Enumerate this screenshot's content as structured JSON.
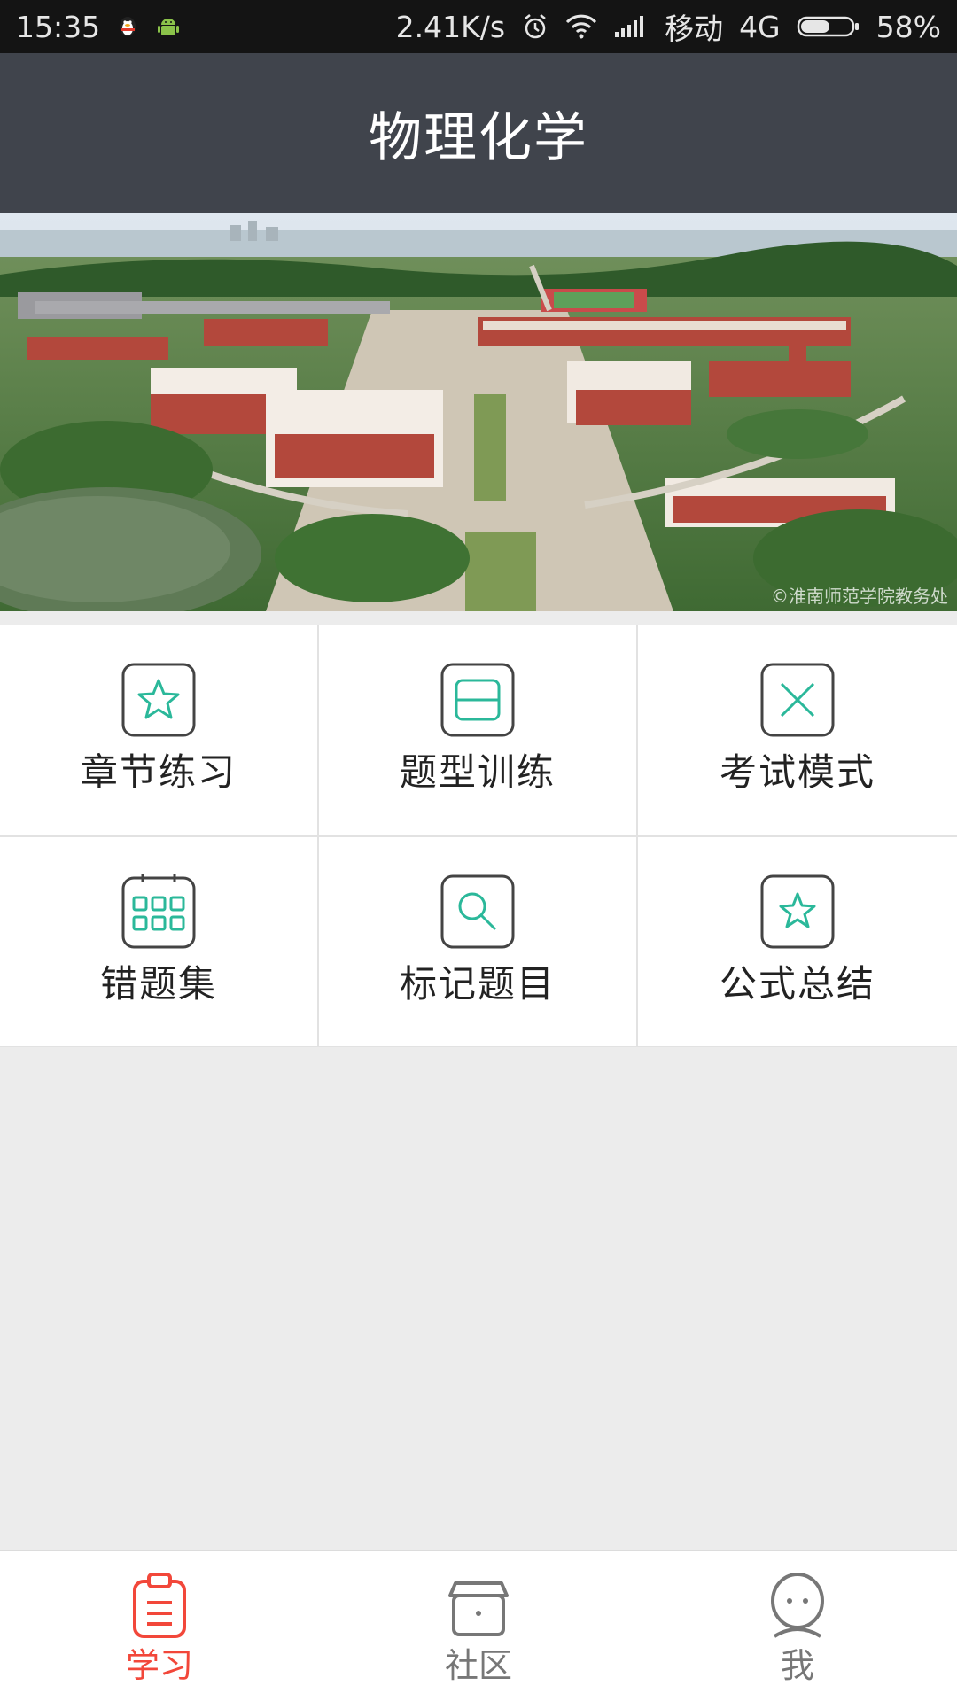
{
  "status_bar": {
    "time": "15:35",
    "net_speed": "2.41K/s",
    "carrier": "移动",
    "network": "4G",
    "battery": "58%",
    "battery_level": 0.58
  },
  "header": {
    "title": "物理化学"
  },
  "banner": {
    "watermark": "©淮南师范学院教务处"
  },
  "menu": {
    "items": [
      {
        "label": "章节练习",
        "icon": "star-icon"
      },
      {
        "label": "题型训练",
        "icon": "card-icon"
      },
      {
        "label": "考试模式",
        "icon": "close-x-icon"
      },
      {
        "label": "错题集",
        "icon": "calendar-grid-icon"
      },
      {
        "label": "标记题目",
        "icon": "search-icon"
      },
      {
        "label": "公式总结",
        "icon": "star-icon"
      }
    ],
    "accent_color": "#2bb89a"
  },
  "bottom_nav": {
    "items": [
      {
        "label": "学习",
        "icon": "clipboard-icon",
        "active": true
      },
      {
        "label": "社区",
        "icon": "box-icon",
        "active": false
      },
      {
        "label": "我",
        "icon": "profile-icon",
        "active": false
      }
    ],
    "active_color": "#f2473a",
    "inactive_color": "#777777"
  }
}
